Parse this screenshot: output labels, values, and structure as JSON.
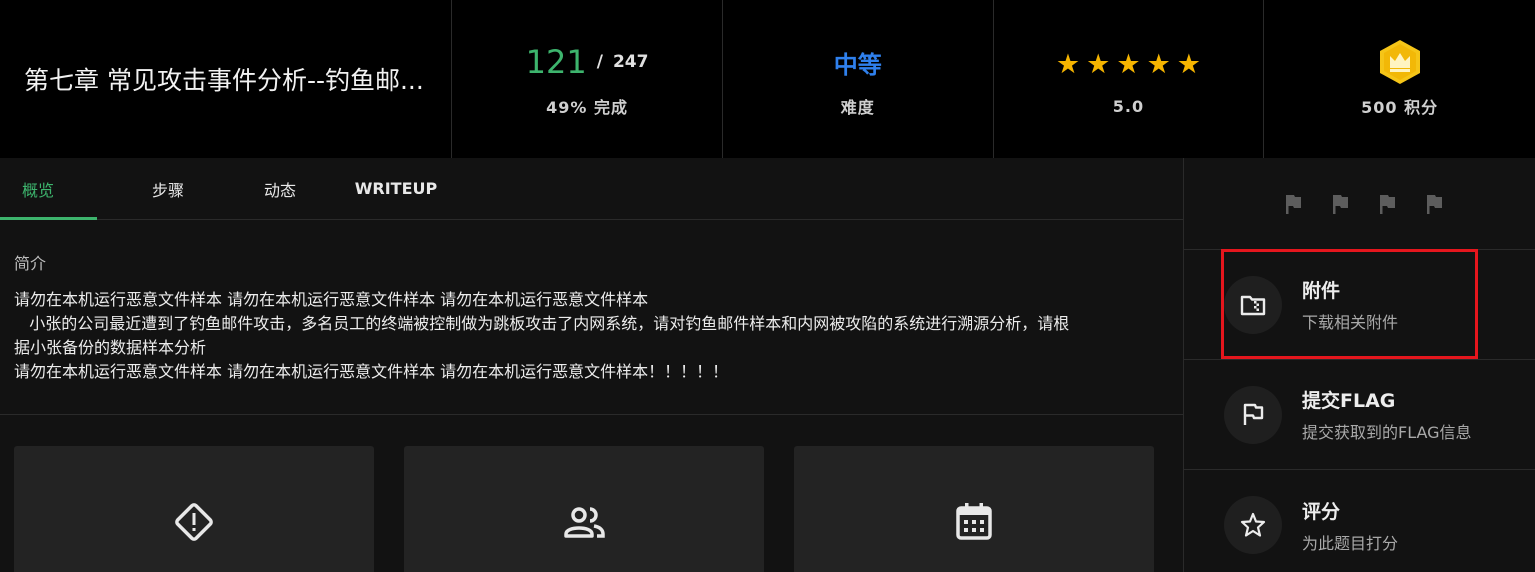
{
  "header": {
    "title": "第七章 常见攻击事件分析--钓鱼邮...",
    "progress": {
      "done": "121",
      "sep": "/",
      "total": "247",
      "label": "49% 完成",
      "percent": 49
    },
    "difficulty": {
      "value": "中等",
      "label": "难度",
      "color": "#2f80ed"
    },
    "rating": {
      "stars": 5,
      "value": "5.0"
    },
    "points": {
      "label": "500 积分",
      "badge_icon": "crown-badge-icon",
      "badge_color": "#f5c518"
    }
  },
  "tabs": [
    {
      "label": "概览",
      "active": true
    },
    {
      "label": "步骤",
      "active": false
    },
    {
      "label": "动态",
      "active": false
    },
    {
      "label": "WRITEUP",
      "active": false
    }
  ],
  "intro": {
    "label": "简介",
    "lines": [
      "请勿在本机运行恶意文件样本 请勿在本机运行恶意文件样本 请勿在本机运行恶意文件样本",
      "   小张的公司最近遭到了钓鱼邮件攻击，多名员工的终端被控制做为跳板攻击了内网系统，请对钓鱼邮件样本和内网被攻陷的系统进行溯源分析，请根",
      "据小张备份的数据样本分析",
      "请勿在本机运行恶意文件样本 请勿在本机运行恶意文件样本 请勿在本机运行恶意文件样本！！！！！"
    ]
  },
  "cards": [
    {
      "icon": "alert-diamond-icon"
    },
    {
      "icon": "users-icon"
    },
    {
      "icon": "calendar-icon"
    }
  ],
  "sidebar": {
    "flags_count": 4,
    "items": [
      {
        "title": "附件",
        "desc": "下载相关附件",
        "icon": "folder-icon",
        "highlighted": true
      },
      {
        "title": "提交FLAG",
        "desc": "提交获取到的FLAG信息",
        "icon": "flag-icon",
        "highlighted": false
      },
      {
        "title": "评分",
        "desc": "为此题目打分",
        "icon": "star-outline-icon",
        "highlighted": false
      }
    ]
  },
  "colors": {
    "accent": "#3db46d",
    "highlight_border": "#e5161d",
    "star": "#f5b400"
  }
}
